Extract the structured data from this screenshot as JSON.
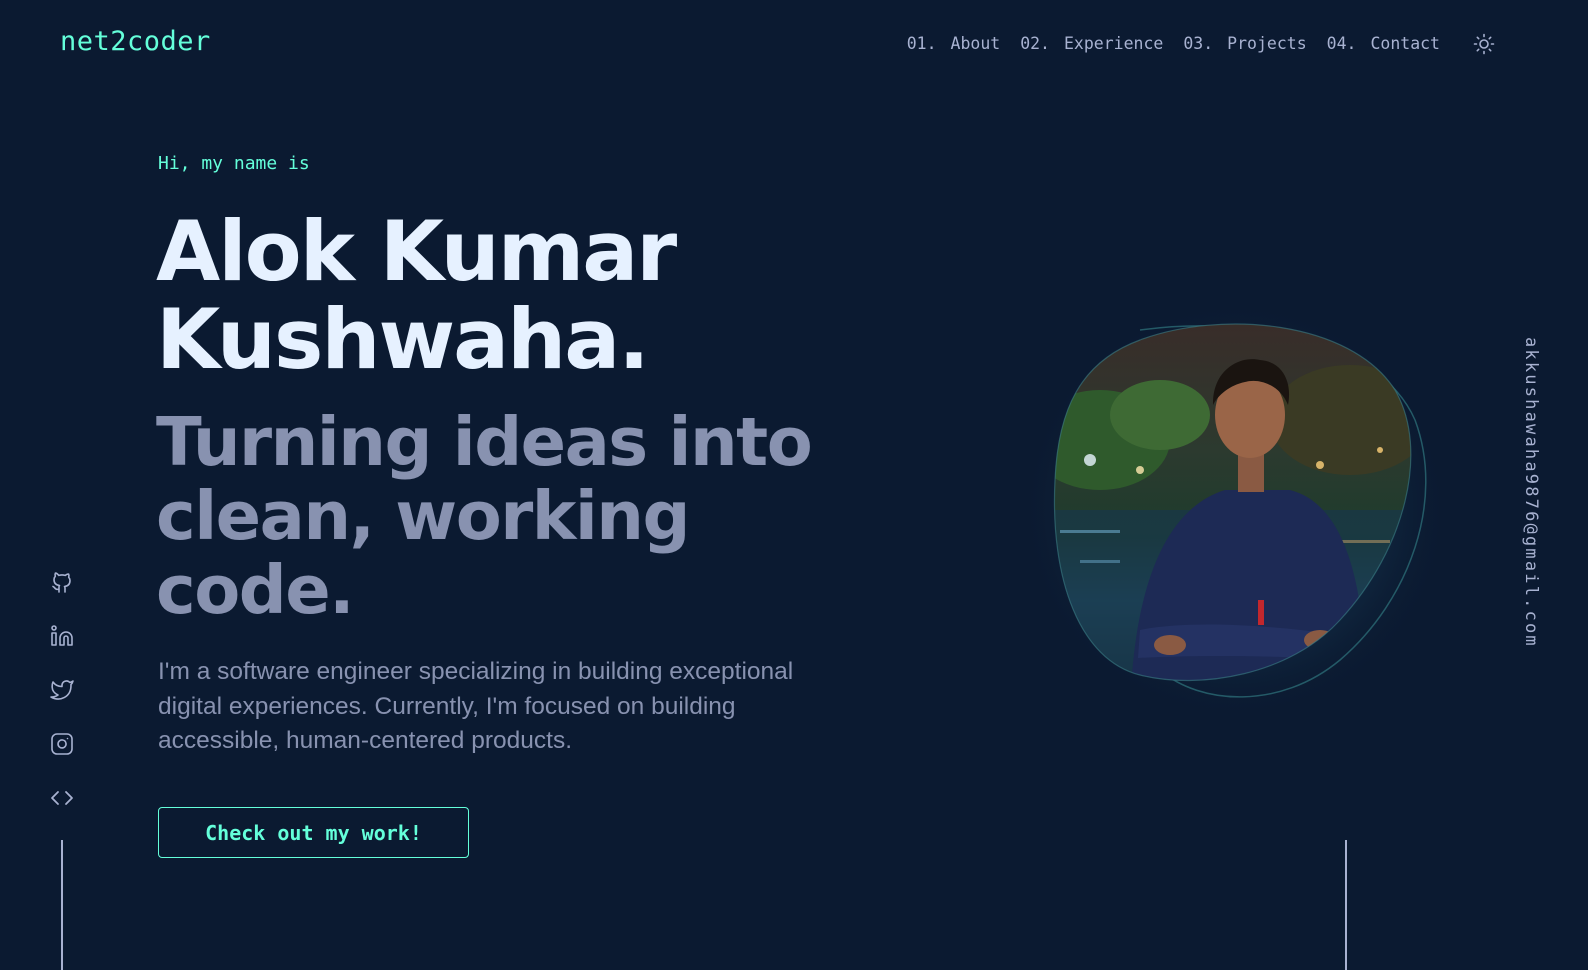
{
  "header": {
    "logo": "net2coder",
    "nav": [
      {
        "num": "01.",
        "label": "About"
      },
      {
        "num": "02.",
        "label": "Experience"
      },
      {
        "num": "03.",
        "label": "Projects"
      },
      {
        "num": "04.",
        "label": "Contact"
      }
    ],
    "theme_toggle_icon": "sun-icon"
  },
  "hero": {
    "greeting": "Hi, my name is",
    "name_line1": "Alok Kumar",
    "name_line2": "Kushwaha.",
    "tagline_line1": "Turning ideas into",
    "tagline_line2": "clean, working",
    "tagline_line3": "code.",
    "intro_line1": "I'm a software engineer specializing in building exceptional",
    "intro_line2": "digital experiences. Currently, I'm focused on building",
    "intro_line3": "accessible, human-centered products.",
    "cta_label": "Check out my work!"
  },
  "social": [
    {
      "name": "github-icon"
    },
    {
      "name": "linkedin-icon"
    },
    {
      "name": "twitter-icon"
    },
    {
      "name": "instagram-icon"
    },
    {
      "name": "code-icon"
    }
  ],
  "email": "akkushawaha9876@gmail.com",
  "colors": {
    "background": "#0b1a31",
    "accent": "#64ffda",
    "heading": "#e6f1ff",
    "muted": "#8892b0",
    "nav_text": "#a8b2d1"
  }
}
